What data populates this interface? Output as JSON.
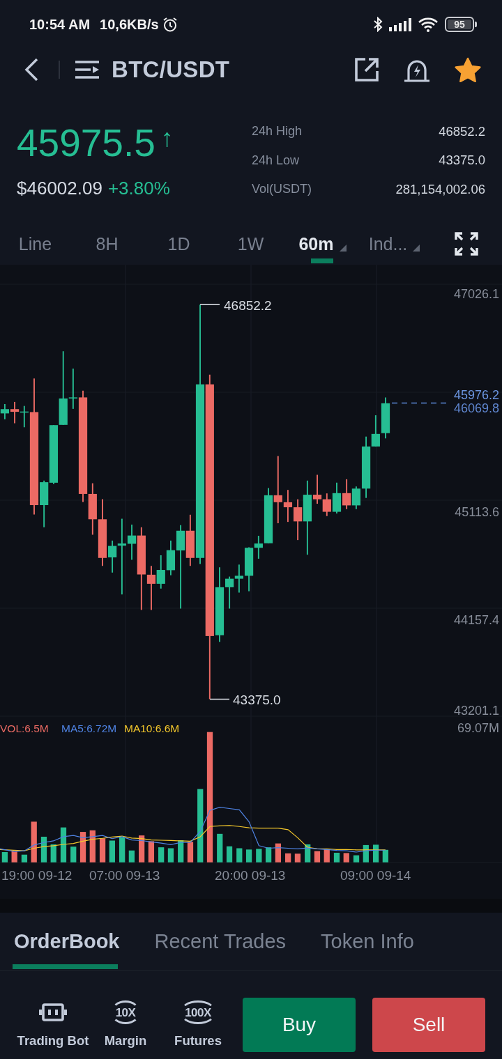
{
  "status_bar": {
    "time": "10:54 AM",
    "net_speed": "10,6KB/s",
    "battery": "95"
  },
  "header": {
    "title": "BTC/USDT",
    "favorite": true
  },
  "ticker": {
    "price": "45975.5",
    "arrow": "↑",
    "rising": true,
    "fiat_price": "$46002.09",
    "change": "+3.80%"
  },
  "stats": [
    {
      "label": "24h High",
      "value": "46852.2"
    },
    {
      "label": "24h Low",
      "value": "43375.0"
    },
    {
      "label": "Vol(USDT)",
      "value": "281,154,002.06"
    }
  ],
  "intervals": [
    {
      "label": "Line",
      "selected": false,
      "dropdown": false
    },
    {
      "label": "8H",
      "selected": false,
      "dropdown": false
    },
    {
      "label": "1D",
      "selected": false,
      "dropdown": false
    },
    {
      "label": "1W",
      "selected": false,
      "dropdown": false
    },
    {
      "label": "60m",
      "selected": true,
      "dropdown": true
    },
    {
      "label": "Ind...",
      "selected": false,
      "dropdown": true
    }
  ],
  "chart": {
    "price_axis": [
      "47026.1",
      "46069.8",
      "45113.6",
      "44157.4",
      "43201.1"
    ],
    "last_price": "45976.2",
    "high_marker": "46852.2",
    "low_marker": "43375.0",
    "volume_legend": [
      {
        "label": "VOL:6.5M",
        "color": "#ea6a63"
      },
      {
        "label": "MA5:6.72M",
        "color": "#4f83e3"
      },
      {
        "label": "MA10:6.6M",
        "color": "#f3c72c"
      }
    ],
    "volume_max": "69.07M",
    "time_axis": [
      "19:00 09-12",
      "07:00 09-13",
      "20:00 09-13",
      "09:00 09-14"
    ]
  },
  "tabs": [
    {
      "label": "OrderBook",
      "selected": true
    },
    {
      "label": "Recent Trades",
      "selected": false
    },
    {
      "label": "Token Info",
      "selected": false
    }
  ],
  "shortcuts": [
    {
      "label": "Trading Bot",
      "kind": "bot"
    },
    {
      "label": "Margin",
      "kind": "leverage",
      "badge": "10X"
    },
    {
      "label": "Futures",
      "kind": "leverage",
      "badge": "100X"
    }
  ],
  "buttons": [
    {
      "label": "Buy",
      "kind": "buy"
    },
    {
      "label": "Sell",
      "kind": "sell"
    }
  ]
}
